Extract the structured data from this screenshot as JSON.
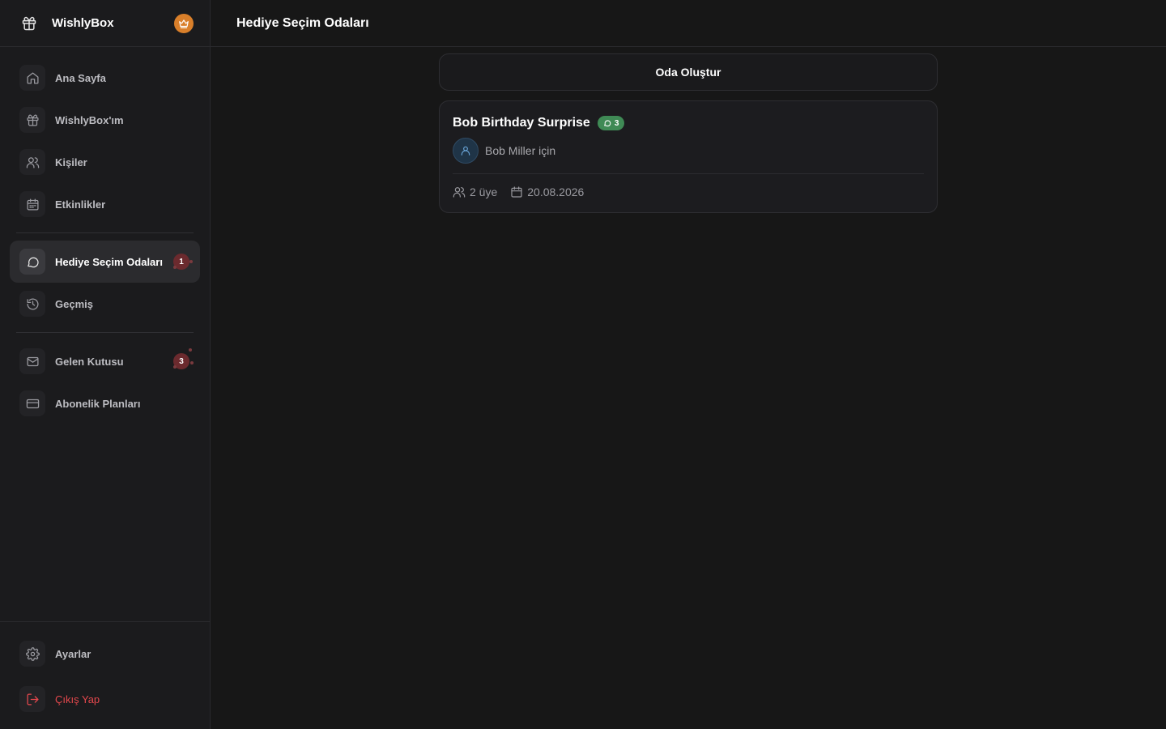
{
  "app": {
    "name": "WishlyBox"
  },
  "sidebar": {
    "items": [
      {
        "label": "Ana Sayfa",
        "icon": "home-icon"
      },
      {
        "label": "WishlyBox'ım",
        "icon": "gift-icon"
      },
      {
        "label": "Kişiler",
        "icon": "users-icon"
      },
      {
        "label": "Etkinlikler",
        "icon": "calendar-icon"
      },
      {
        "label": "Hediye Seçim Odaları",
        "icon": "chat-icon",
        "active": true,
        "badge": "1"
      },
      {
        "label": "Geçmiş",
        "icon": "history-icon"
      },
      {
        "label": "Gelen Kutusu",
        "icon": "mail-icon",
        "badge": "3"
      },
      {
        "label": "Abonelik Planları",
        "icon": "credit-card-icon"
      }
    ],
    "bottom": [
      {
        "label": "Ayarlar",
        "icon": "gear-icon"
      },
      {
        "label": "Çıkış Yap",
        "icon": "logout-icon"
      }
    ]
  },
  "header": {
    "title": "Hediye Seçim Odaları"
  },
  "main": {
    "create_button": "Oda Oluştur",
    "rooms": [
      {
        "title": "Bob Birthday Surprise",
        "message_count": "3",
        "recipient": "Bob Miller için",
        "members": "2 üye",
        "date": "20.08.2026"
      }
    ]
  },
  "colors": {
    "background": "#171717",
    "sidebar": "#1b1b1d",
    "accent_crown": "#d97f2a",
    "badge": "#6b2a2e",
    "message_pill": "#3f8a55",
    "logout": "#e5484d"
  }
}
